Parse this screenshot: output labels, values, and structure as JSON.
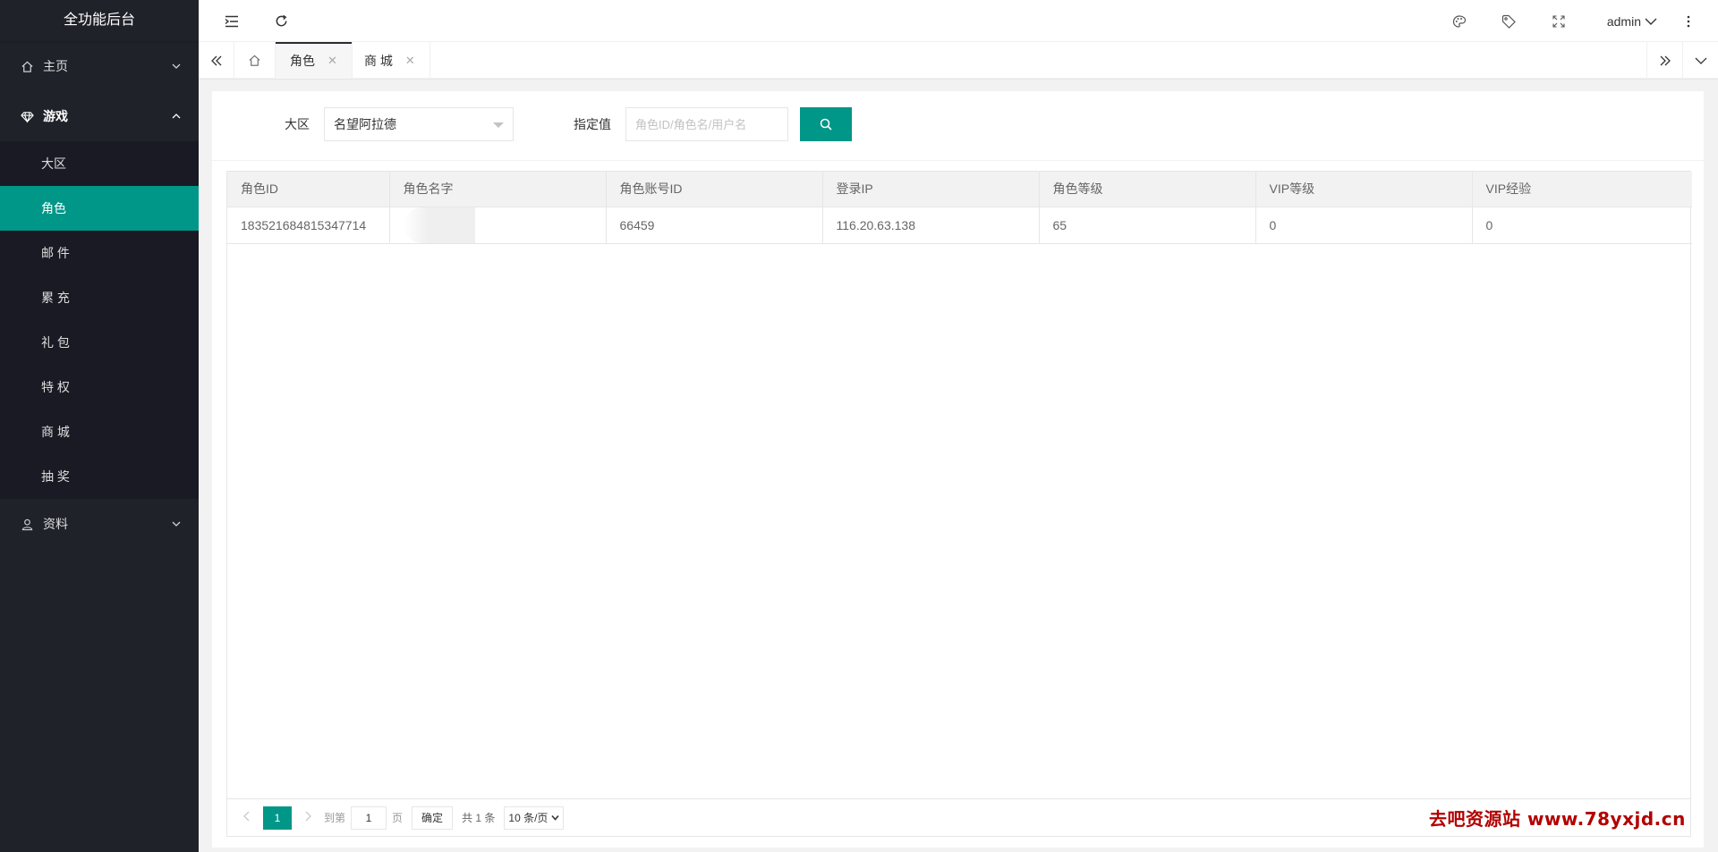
{
  "sidebar": {
    "logo": "全功能后台",
    "groups": [
      {
        "label": "主页",
        "icon": "home-icon",
        "expanded": false
      },
      {
        "label": "游戏",
        "icon": "diamond-icon",
        "expanded": true,
        "items": [
          {
            "label": "大区",
            "active": false
          },
          {
            "label": "角色",
            "active": true
          },
          {
            "label": "邮 件",
            "active": false
          },
          {
            "label": "累 充",
            "active": false
          },
          {
            "label": "礼 包",
            "active": false
          },
          {
            "label": "特 权",
            "active": false
          },
          {
            "label": "商 城",
            "active": false
          },
          {
            "label": "抽 奖",
            "active": false
          }
        ]
      },
      {
        "label": "资料",
        "icon": "user-icon",
        "expanded": false
      }
    ]
  },
  "header": {
    "user": "admin",
    "icons": [
      "flexible-menu-icon",
      "refresh-icon",
      "theme-icon",
      "tag-icon",
      "fullscreen-icon",
      "more-vertical-icon"
    ]
  },
  "tabs": [
    {
      "label": "角色",
      "active": true
    },
    {
      "label": "商 城",
      "active": false
    }
  ],
  "filter": {
    "region_label": "大区",
    "region_value": "名望阿拉德",
    "value_label": "指定值",
    "value_placeholder": "角色ID/角色名/用户名"
  },
  "table": {
    "columns": [
      "角色ID",
      "角色名字",
      "角色账号ID",
      "登录IP",
      "角色等级",
      "VIP等级",
      "VIP经验"
    ],
    "rows": [
      [
        "183521684815347714",
        "",
        "66459",
        "116.20.63.138",
        "65",
        "0",
        "0"
      ]
    ]
  },
  "pager": {
    "current": "1",
    "goto_label": "到第",
    "goto_value": "1",
    "page_label": "页",
    "confirm": "确定",
    "total": "共 1 条",
    "page_size": "10 条/页"
  },
  "watermark": "去吧资源站 www.78yxjd.cn",
  "colors": {
    "accent": "#009688",
    "sidebar": "#20222a",
    "submenu": "#191a23"
  }
}
